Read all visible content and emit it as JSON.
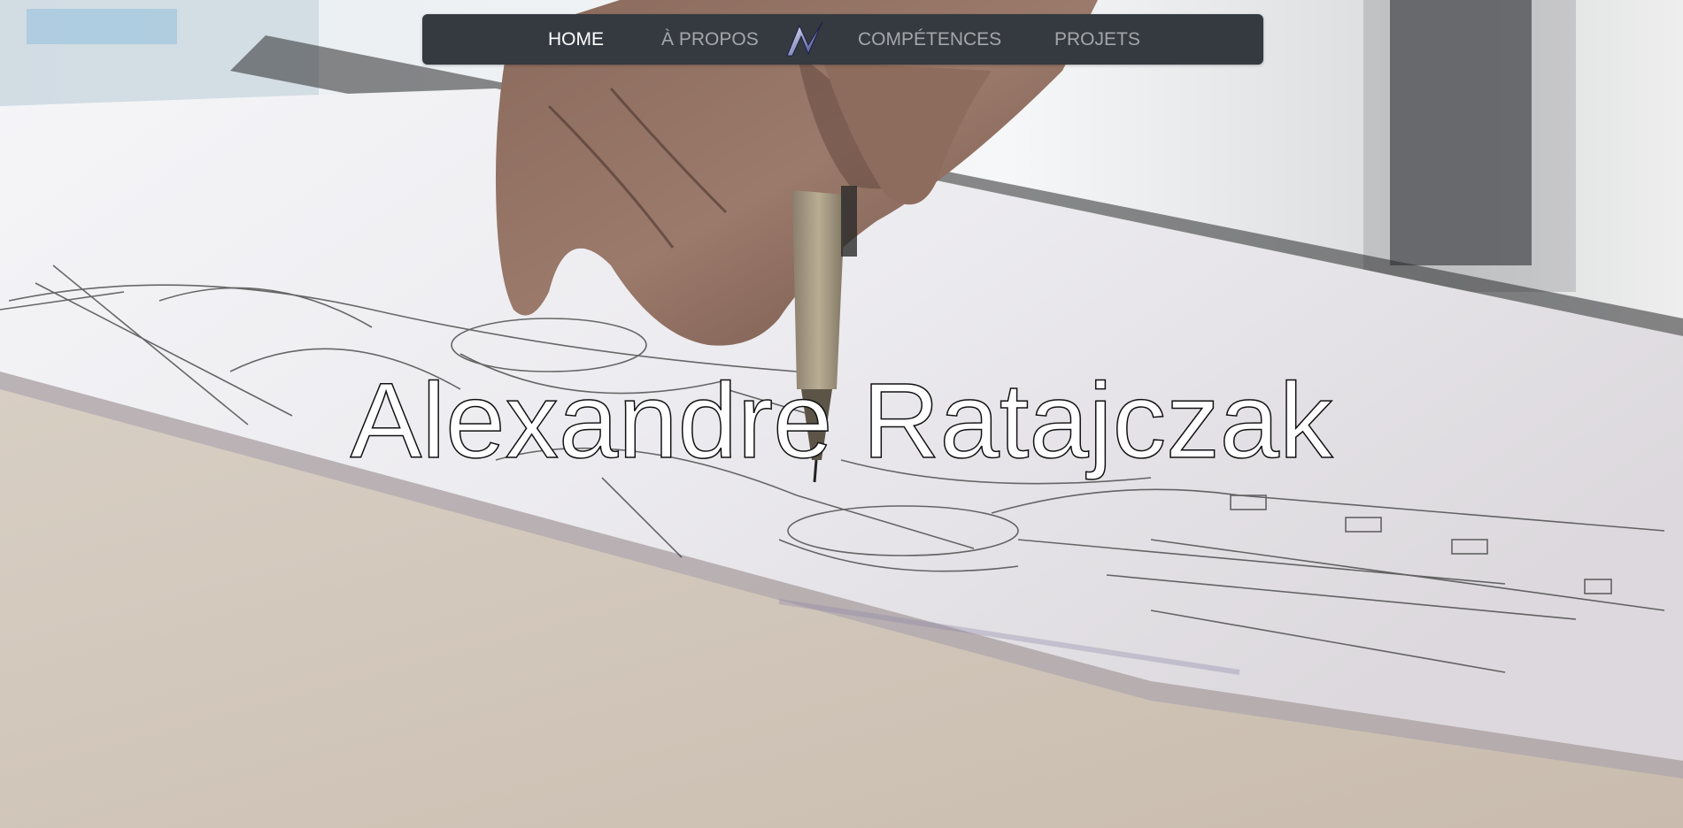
{
  "nav": {
    "home_label": "HOME",
    "apropos_label": "À PROPOS",
    "competences_label": "COMPÉTENCES",
    "projets_label": "PROJETS",
    "logo_icon": "brand-n-logo-icon",
    "active_item": "HOME"
  },
  "hero": {
    "title": "Alexandre Ratajczak",
    "background_image": "hand-sketching-on-paper-photo"
  },
  "colors": {
    "navbar_bg": "#343a40",
    "nav_active": "#ffffff",
    "nav_inactive": "#9a9da1",
    "title_fill": "#ffffff",
    "title_stroke": "#111111"
  }
}
